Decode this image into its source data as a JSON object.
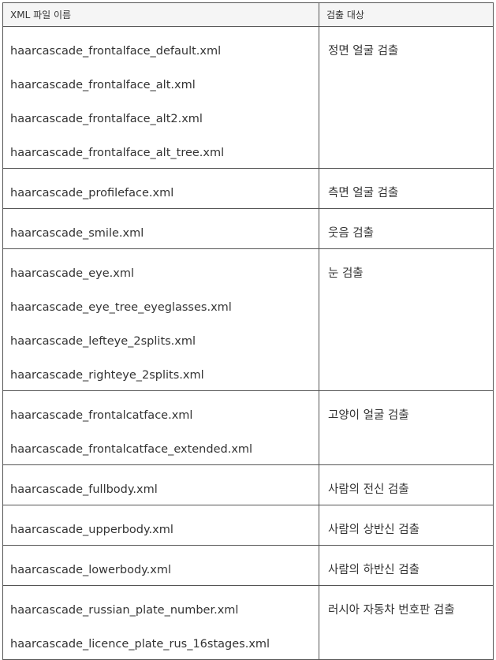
{
  "table": {
    "headers": [
      "XML 파일 이름",
      "검출 대상"
    ],
    "rows": [
      {
        "files": [
          "haarcascade_frontalface_default.xml",
          "haarcascade_frontalface_alt.xml",
          "haarcascade_frontalface_alt2.xml",
          "haarcascade_frontalface_alt_tree.xml"
        ],
        "target": "정면 얼굴 검출"
      },
      {
        "files": [
          "haarcascade_profileface.xml"
        ],
        "target": "측면 얼굴 검출"
      },
      {
        "files": [
          "haarcascade_smile.xml"
        ],
        "target": "웃음 검출"
      },
      {
        "files": [
          "haarcascade_eye.xml",
          "haarcascade_eye_tree_eyeglasses.xml",
          "haarcascade_lefteye_2splits.xml",
          "haarcascade_righteye_2splits.xml"
        ],
        "target": "눈 검출"
      },
      {
        "files": [
          "haarcascade_frontalcatface.xml",
          "haarcascade_frontalcatface_extended.xml"
        ],
        "target": "고양이 얼굴 검출"
      },
      {
        "files": [
          "haarcascade_fullbody.xml"
        ],
        "target": "사람의 전신 검출"
      },
      {
        "files": [
          "haarcascade_upperbody.xml"
        ],
        "target": "사람의 상반신 검출"
      },
      {
        "files": [
          "haarcascade_lowerbody.xml"
        ],
        "target": "사람의 하반신 검출"
      },
      {
        "files": [
          "haarcascade_russian_plate_number.xml",
          "haarcascade_licence_plate_rus_16stages.xml"
        ],
        "target": "러시아 자동차 번호판 검출"
      }
    ]
  }
}
